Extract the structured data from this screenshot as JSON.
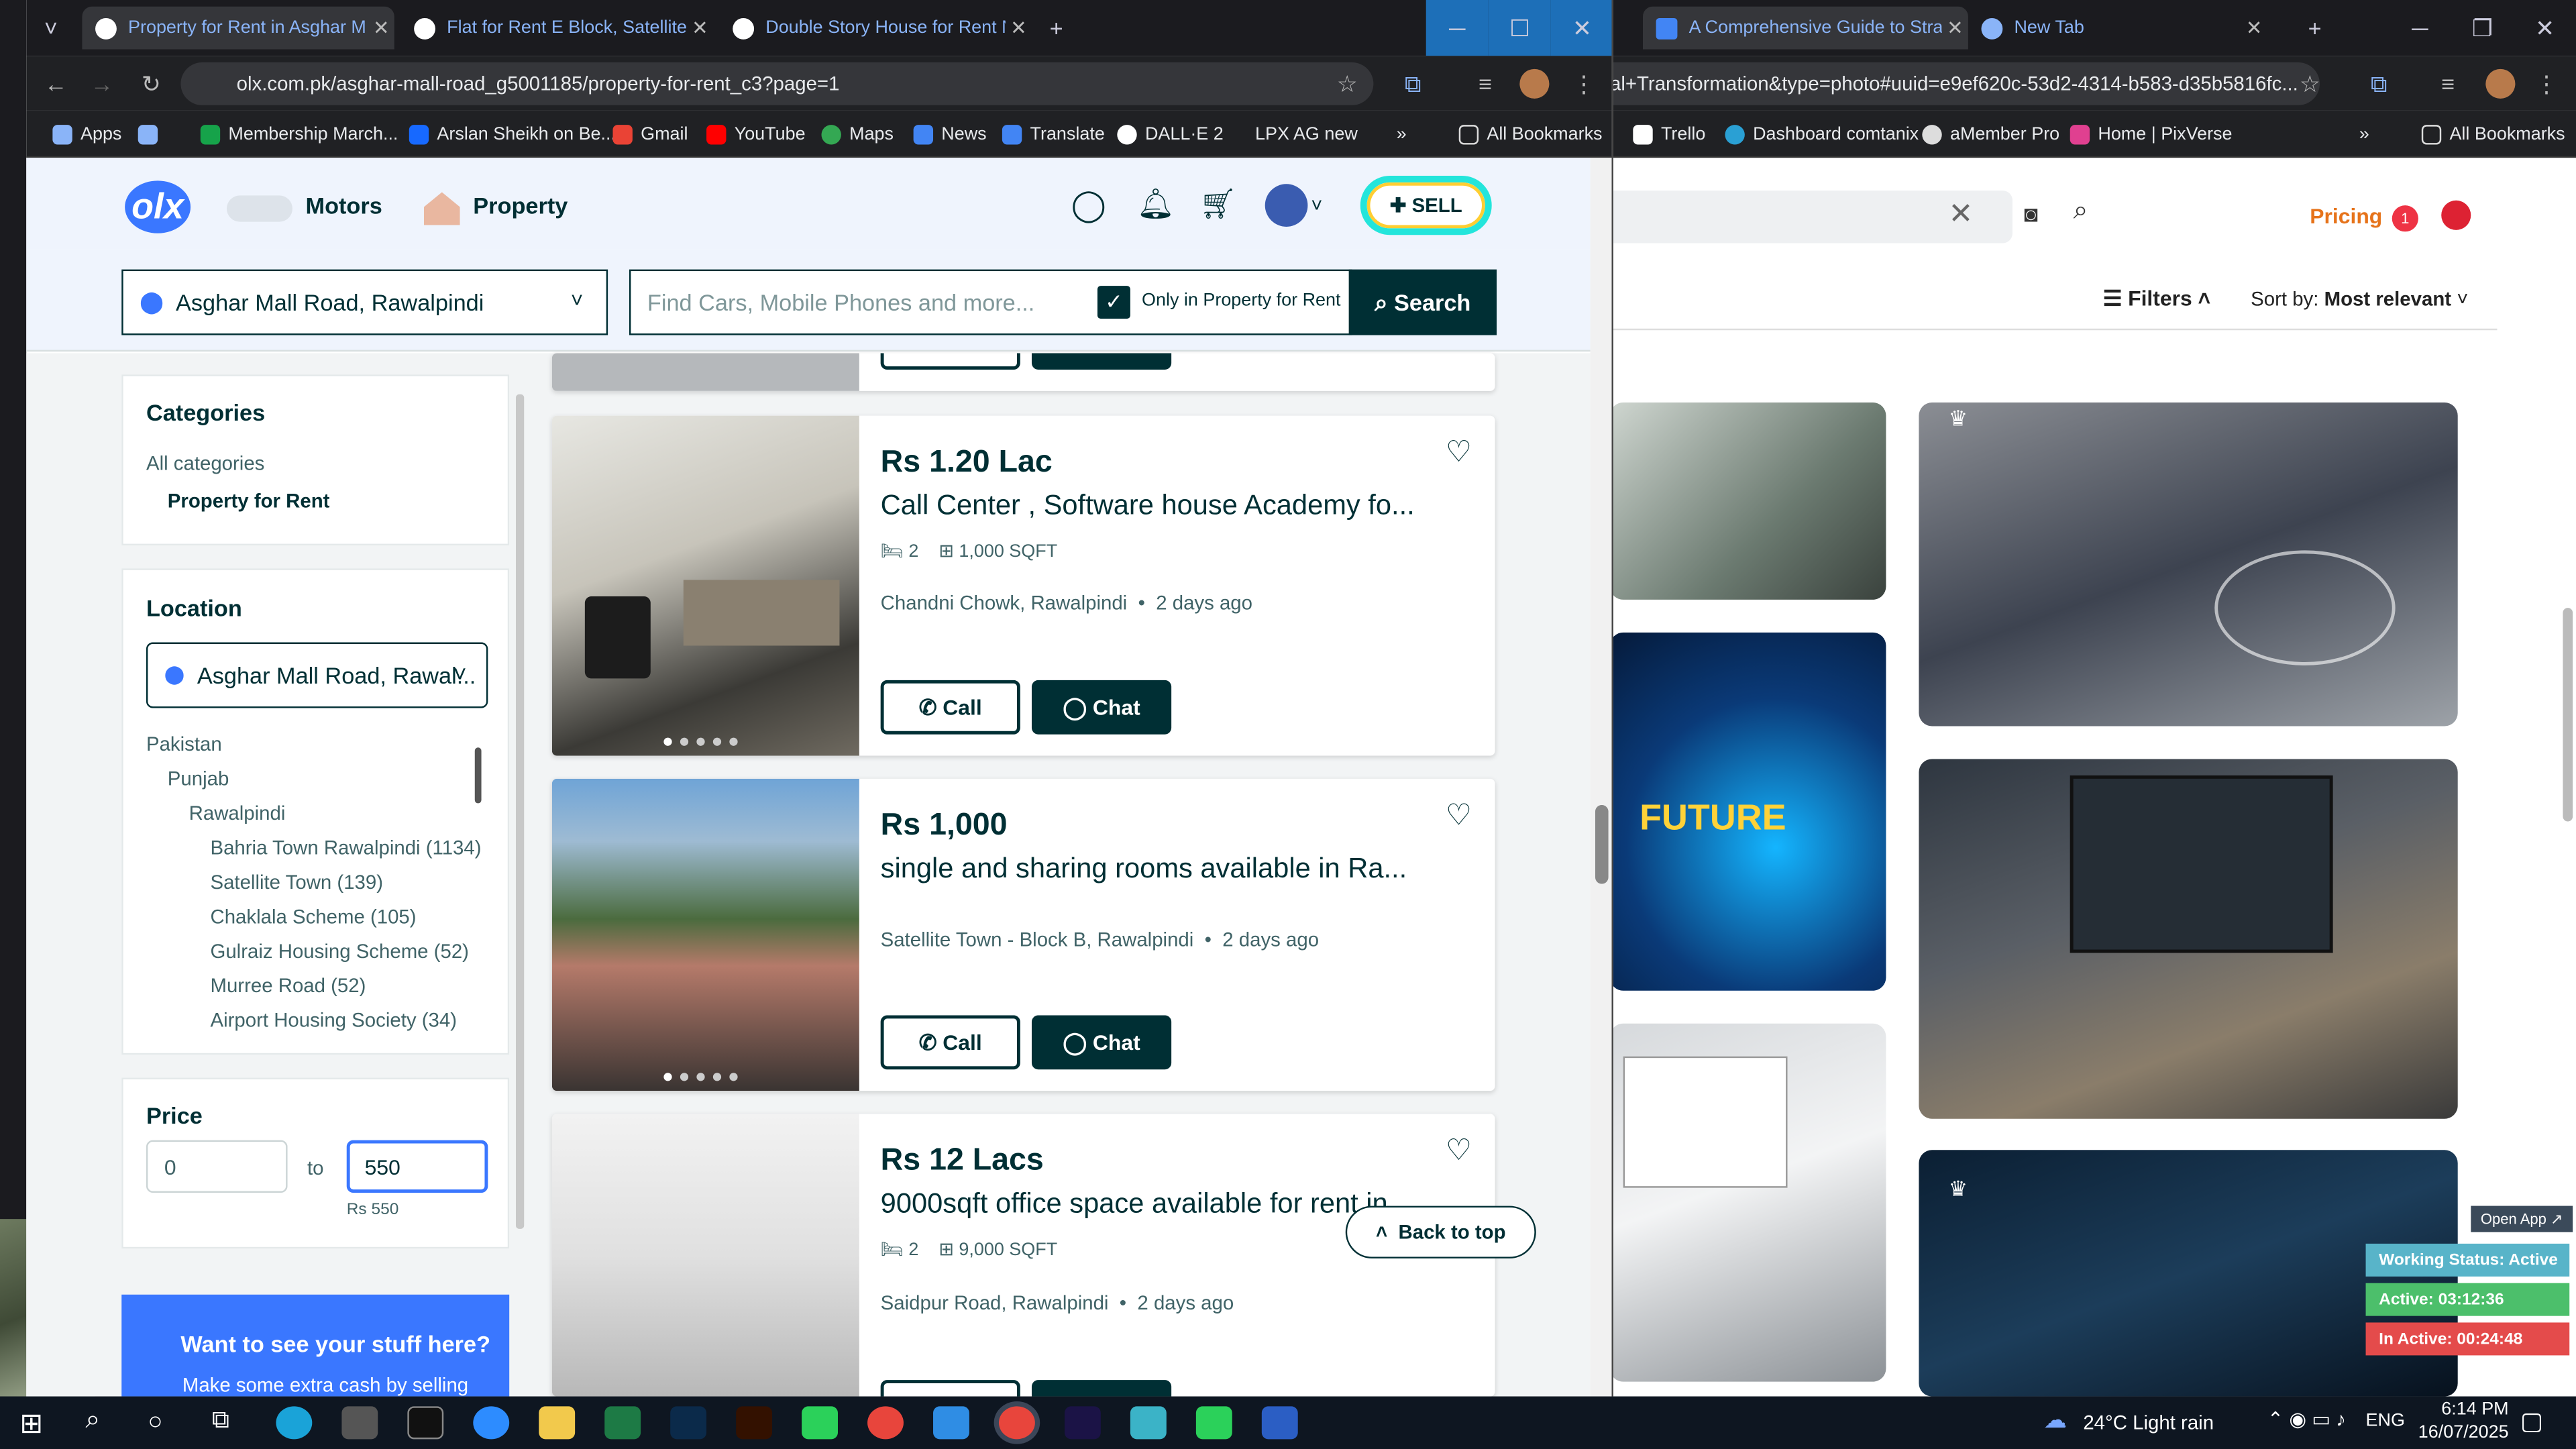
{
  "browser1": {
    "tabs": [
      {
        "label": "Property for Rent in Asghar M"
      },
      {
        "label": "Flat for Rent E Block, Satellite T"
      },
      {
        "label": "Double Story House for Rent N"
      }
    ],
    "url": "olx.com.pk/asghar-mall-road_g5001185/property-for-rent_c3?page=1",
    "bookmarks": [
      "Apps",
      "Membership March...",
      "Arslan Sheikh on Be...",
      "Gmail",
      "YouTube",
      "Maps",
      "News",
      "Translate",
      "DALL·E 2",
      "LPX AG new"
    ],
    "all_bookmarks": "All Bookmarks"
  },
  "browser2": {
    "tabs": [
      {
        "label": "A Comprehensive Guide to Stra"
      },
      {
        "label": "New Tab"
      }
    ],
    "url": "al+Transformation&type=photo#uuid=e9ef620c-53d2-4314-b583-d35b5816fc...",
    "bookmarks": [
      "Trello",
      "Dashboard comtanix",
      "aMember Pro",
      "Home | PixVerse"
    ],
    "all_bookmarks": "All Bookmarks",
    "pricing": "Pricing",
    "badge": "1",
    "filters": "Filters",
    "sort_label": "Sort by:",
    "sort_value": "Most relevant",
    "open_app": "Open App ↗",
    "status": [
      "Working Status: Active",
      "Active: 03:12:36",
      "In Active: 00:24:48"
    ],
    "future_text": "FUTURE"
  },
  "olx": {
    "logo": "olx",
    "motors": "Motors",
    "property": "Property",
    "sell": "SELL",
    "location": "Asghar Mall Road, Rawalpindi",
    "search_placeholder": "Find Cars, Mobile Phones and more...",
    "only_in": "Only in Property for Rent",
    "search_btn": "Search",
    "categories_title": "Categories",
    "all_categories": "All categories",
    "active_category": "Property for Rent",
    "location_title": "Location",
    "location_select": "Asghar Mall Road, Rawal...",
    "loc_tree": [
      "Pakistan",
      "Punjab",
      "Rawalpindi",
      "Bahria Town Rawalpindi (1134)",
      "Satellite Town (139)",
      "Chaklala Scheme (105)",
      "Gulraiz Housing Scheme (52)",
      "Murree Road (52)",
      "Airport Housing Society (34)"
    ],
    "price_title": "Price",
    "price_min": "0",
    "price_to": "to",
    "price_max": "550",
    "price_hint": "Rs 550",
    "promo_title": "Want to see your stuff here?",
    "promo_sub": "Make some extra cash by selling",
    "back_to_top": "Back to top",
    "ads": [
      {
        "price": "Rs 1.20 Lac",
        "title": "Call Center , Software house Academy fo...",
        "beds": "2",
        "area": "1,000 SQFT",
        "location": "Chandni Chowk, Rawalpindi",
        "time": "2 days ago",
        "call": "Call",
        "chat": "Chat"
      },
      {
        "price": "Rs 1,000",
        "title": "single and sharing rooms available in Ra...",
        "location": "Satellite Town - Block B, Rawalpindi",
        "time": "2 days ago",
        "call": "Call",
        "chat": "Chat"
      },
      {
        "price": "Rs 12 Lacs",
        "title": "9000sqft office space available for rent in...",
        "beds": "2",
        "area": "9,000 SQFT",
        "location": "Saidpur Road, Rawalpindi",
        "time": "2 days ago"
      }
    ]
  },
  "taskbar": {
    "weather": "24°C  Light rain",
    "lang": "ENG",
    "time": "6:14 PM",
    "date": "16/07/2025"
  }
}
